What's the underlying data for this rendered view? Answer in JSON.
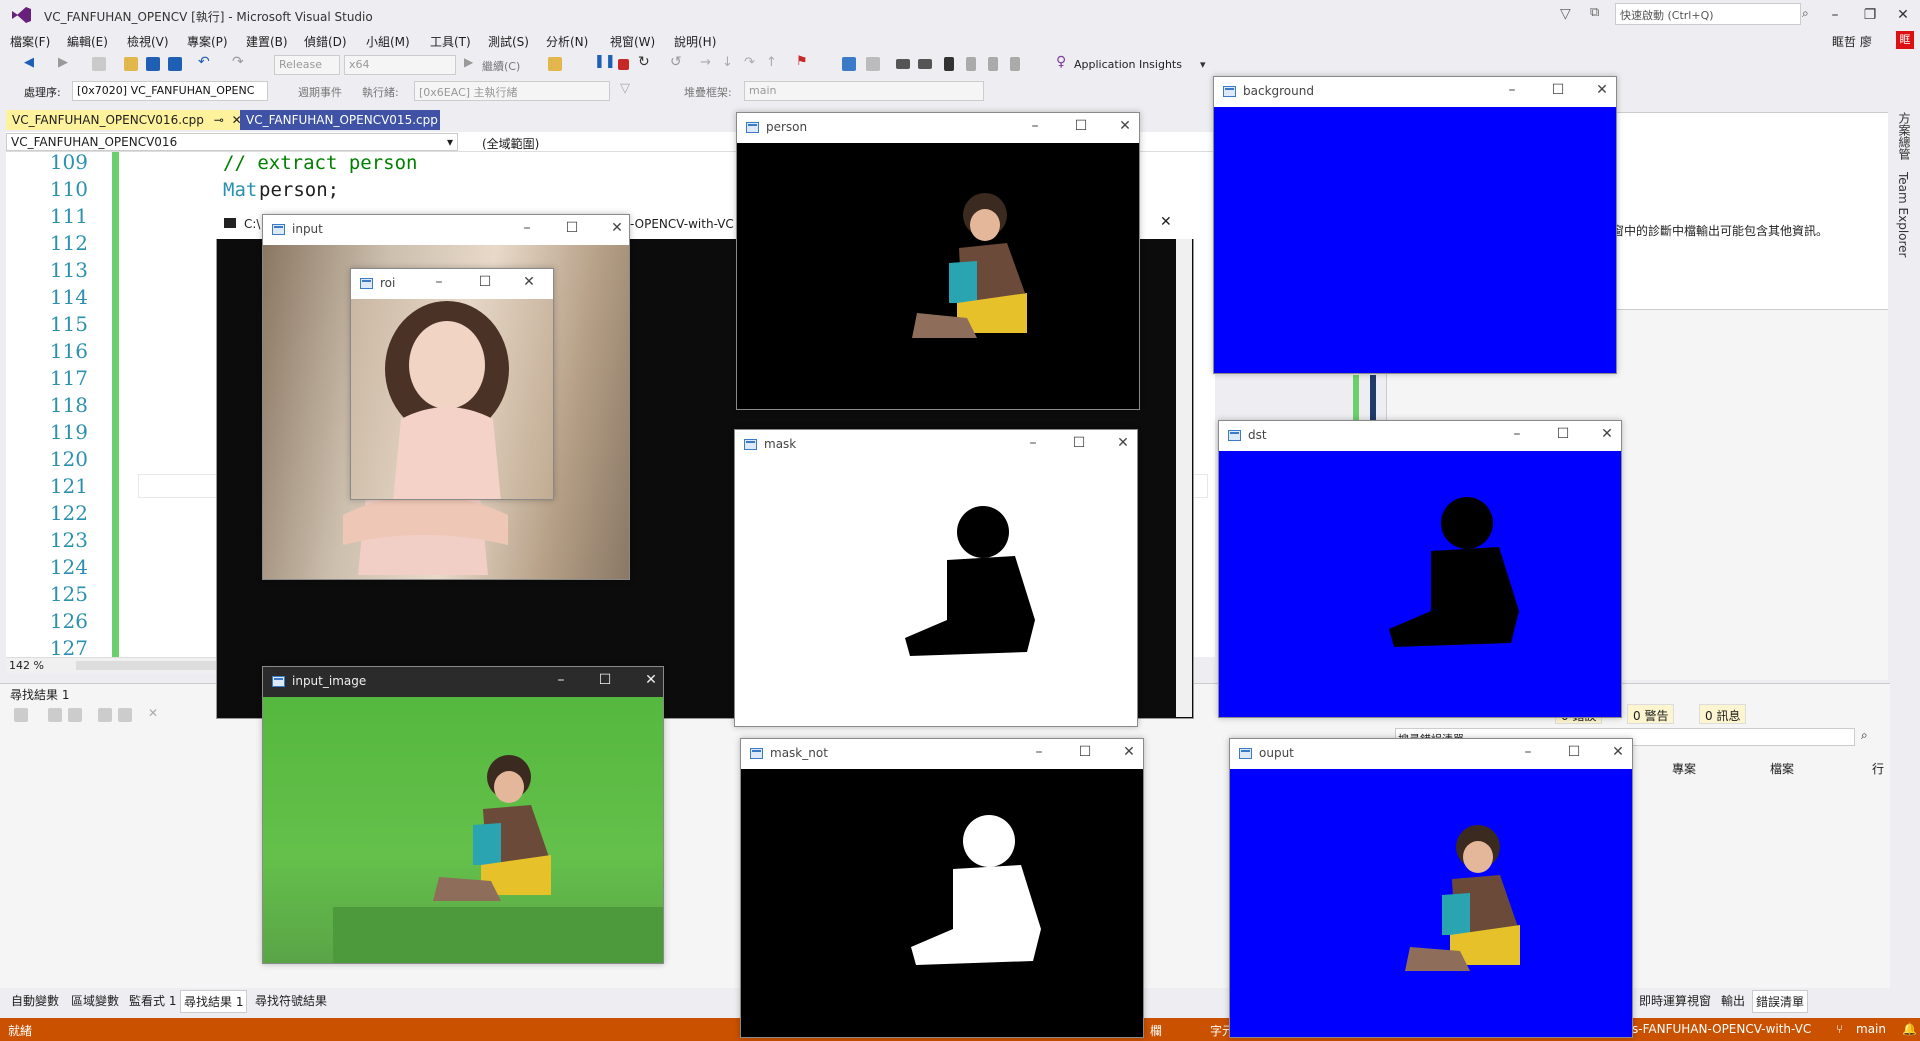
{
  "window": {
    "title": "VC_FANFUHAN_OPENCV [執行] - Microsoft Visual Studio",
    "quick_launch_placeholder": "快速啟動 (Ctrl+Q)",
    "user": "眶哲 廖"
  },
  "menu": [
    "檔案(F)",
    "編輯(E)",
    "檢視(V)",
    "專案(P)",
    "建置(B)",
    "偵錯(D)",
    "小組(M)",
    "工具(T)",
    "測試(S)",
    "分析(N)",
    "視窗(W)",
    "說明(H)"
  ],
  "toolbar": {
    "config": "Release",
    "platform": "x64",
    "continue_label": "繼續(C)",
    "app_insights": "Application Insights",
    "process_label": "處理序:",
    "process_value": "[0x7020] VC_FANFUHAN_OPENC",
    "lifecycle_label": "週期事件",
    "thread_label": "執行緒:",
    "thread_value": "[0x6EAC] 主執行緒",
    "stack_label": "堆疊框架:",
    "stack_value": "main"
  },
  "tabs": {
    "active": "VC_FANFUHAN_OPENCV016.cpp",
    "inactive": "VC_FANFUHAN_OPENCV015.cpp"
  },
  "navbar": {
    "project": "VC_FANFUHAN_OPENCV016",
    "scope": "(全域範圍)"
  },
  "editor": {
    "line_numbers": [
      "109",
      "110",
      "111",
      "112",
      "113",
      "114",
      "115",
      "116",
      "117",
      "118",
      "119",
      "120",
      "121",
      "122",
      "123",
      "124",
      "125",
      "126",
      "127"
    ],
    "comment_line": "// extract person",
    "type_keyword": "Mat",
    "decl_rest": " person;",
    "zoom": "142 %"
  },
  "console": {
    "title_prefix": "C:\\",
    "title_suffix": "-OPENCV-with-VC"
  },
  "right_panel": {
    "diag_text": "視窗中的診斷中檔輸出可能包含其他資訊。",
    "side_tab_1": "方案總管",
    "side_tab_2": "Team Explorer"
  },
  "bottom": {
    "find_title": "尋找結果 1",
    "errors": "0 錯誤",
    "warnings": "0 警告",
    "messages": "0 訊息",
    "search_label": "搜尋錯誤清單",
    "col_project": "專案",
    "col_file": "檔案",
    "col_line": "行",
    "tabs_left": [
      "自動變數",
      "區域變數",
      "監看式 1",
      "尋找結果 1",
      "尋找符號結果"
    ],
    "tabs_right": [
      "即時運算視窗",
      "輸出",
      "錯誤清單"
    ]
  },
  "status": {
    "ready": "就緒",
    "col": "欄",
    "char": "字元",
    "repo": "s-FANFUHAN-OPENCV-with-VC",
    "branch": "main"
  },
  "cv_windows": {
    "input": "input",
    "roi": "roi",
    "person": "person",
    "mask": "mask",
    "mask_not": "mask_not",
    "input_image": "input_image",
    "background": "background",
    "dst": "dst",
    "ouput": "ouput"
  },
  "colors": {
    "chroma_blue": "#0000fe",
    "green_screen": "#5cbc44",
    "status_orange": "#ca5100",
    "tab_active": "#fff29d"
  }
}
